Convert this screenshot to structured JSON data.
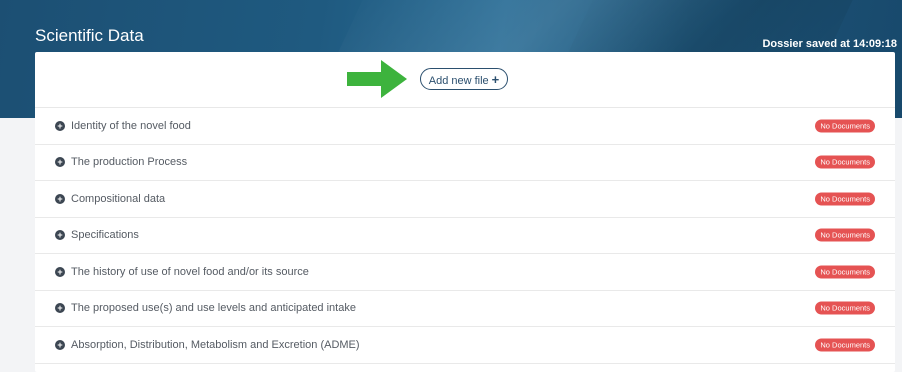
{
  "header": {
    "title": "Scientific Data",
    "saved_status": "Dossier saved at 14:09:18"
  },
  "toolbar": {
    "add_file_label": "Add new file",
    "add_file_icon": "plus-icon",
    "pointer_icon": "green-arrow-icon",
    "pointer_color": "#3db33d"
  },
  "sections": [
    {
      "label": "Identity of the novel food",
      "badge": "No Documents"
    },
    {
      "label": "The production Process",
      "badge": "No Documents"
    },
    {
      "label": "Compositional data",
      "badge": "No Documents"
    },
    {
      "label": "Specifications",
      "badge": "No Documents"
    },
    {
      "label": "The history of use of novel food and/or its source",
      "badge": "No Documents"
    },
    {
      "label": "The proposed use(s) and use levels and anticipated intake",
      "badge": "No Documents"
    },
    {
      "label": "Absorption, Distribution, Metabolism and Excretion (ADME)",
      "badge": "No Documents"
    }
  ],
  "colors": {
    "banner": "#1f5a80",
    "badge": "#e55353",
    "button_border": "#2b4f6e"
  }
}
